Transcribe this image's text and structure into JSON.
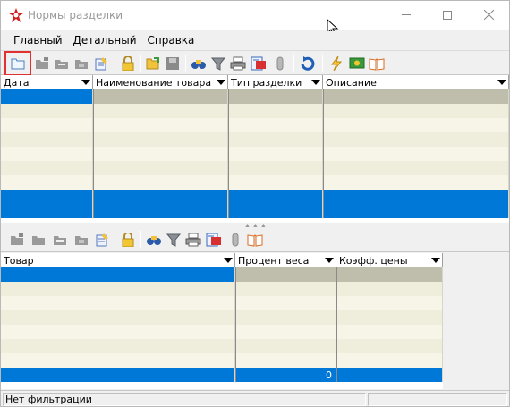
{
  "window": {
    "title": "Нормы разделки",
    "controls": [
      "minimize",
      "maximize",
      "close"
    ]
  },
  "menu": {
    "items": [
      "Главный",
      "Детальный",
      "Справка"
    ]
  },
  "toolbar_top": {
    "buttons": [
      "open-folder-icon",
      "add-record-icon",
      "edit-record-icon",
      "copy-record-icon",
      "edit-note-icon",
      "lock-icon",
      "open-file-icon",
      "save-icon",
      "find-icon",
      "filter-icon",
      "print-icon",
      "report-icon",
      "attach-icon",
      "refresh-icon",
      "lightning-icon",
      "money-icon",
      "book-icon"
    ]
  },
  "grid_top": {
    "columns": [
      "Дата",
      "Наименование товара",
      "Тип разделки",
      "Описание"
    ],
    "row_count": 9,
    "selected_rows": [
      7,
      8
    ]
  },
  "toolbar_bottom": {
    "buttons": [
      "open-folder-icon",
      "add-record-icon",
      "edit-record-icon",
      "copy-record-icon",
      "edit-note-icon",
      "lock-icon",
      "find-icon",
      "filter-icon",
      "print-icon",
      "report-icon",
      "attach-icon",
      "book-icon"
    ]
  },
  "grid_bottom": {
    "columns": [
      "Товар",
      "Процент веса",
      "Коэфф. цены"
    ],
    "row_count": 8,
    "footer_values": [
      "",
      "0",
      ""
    ]
  },
  "status": {
    "text": "Нет фильтрации"
  },
  "colors": {
    "selection": "#0078d7",
    "row_alt_1": "#bfbdac",
    "row_alt_2": "#f7f5e8",
    "row_light": "#efeddc",
    "highlight_border": "#e03030"
  }
}
